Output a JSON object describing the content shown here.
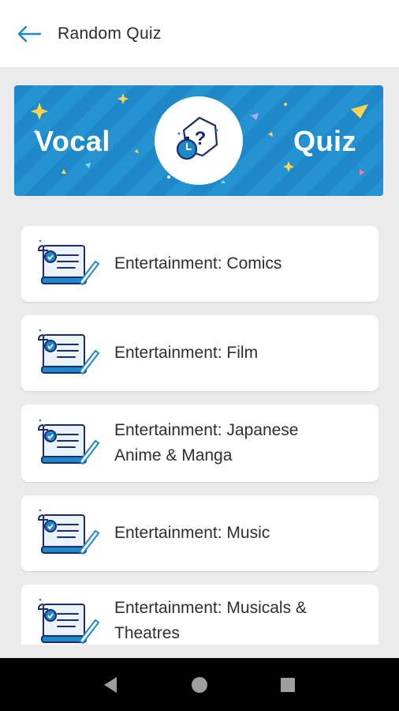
{
  "header": {
    "title": "Random Quiz",
    "back_icon": "arrow-left-icon"
  },
  "banner": {
    "left_word": "Vocal",
    "right_word": "Quiz",
    "center_icon": "stopwatch-question-icon",
    "background_color": "#1e88c8"
  },
  "categories": [
    {
      "label": "Entertainment: Comics",
      "icon": "scroll-quill-icon"
    },
    {
      "label": "Entertainment: Film",
      "icon": "scroll-quill-icon"
    },
    {
      "label": "Entertainment: Japanese Anime & Manga",
      "icon": "scroll-quill-icon"
    },
    {
      "label": "Entertainment: Music",
      "icon": "scroll-quill-icon"
    },
    {
      "label": "Entertainment: Musicals & Theatres",
      "icon": "scroll-quill-icon"
    }
  ],
  "navigation_bar": {
    "back": "triangle-back-icon",
    "home": "circle-home-icon",
    "recents": "square-recents-icon"
  }
}
